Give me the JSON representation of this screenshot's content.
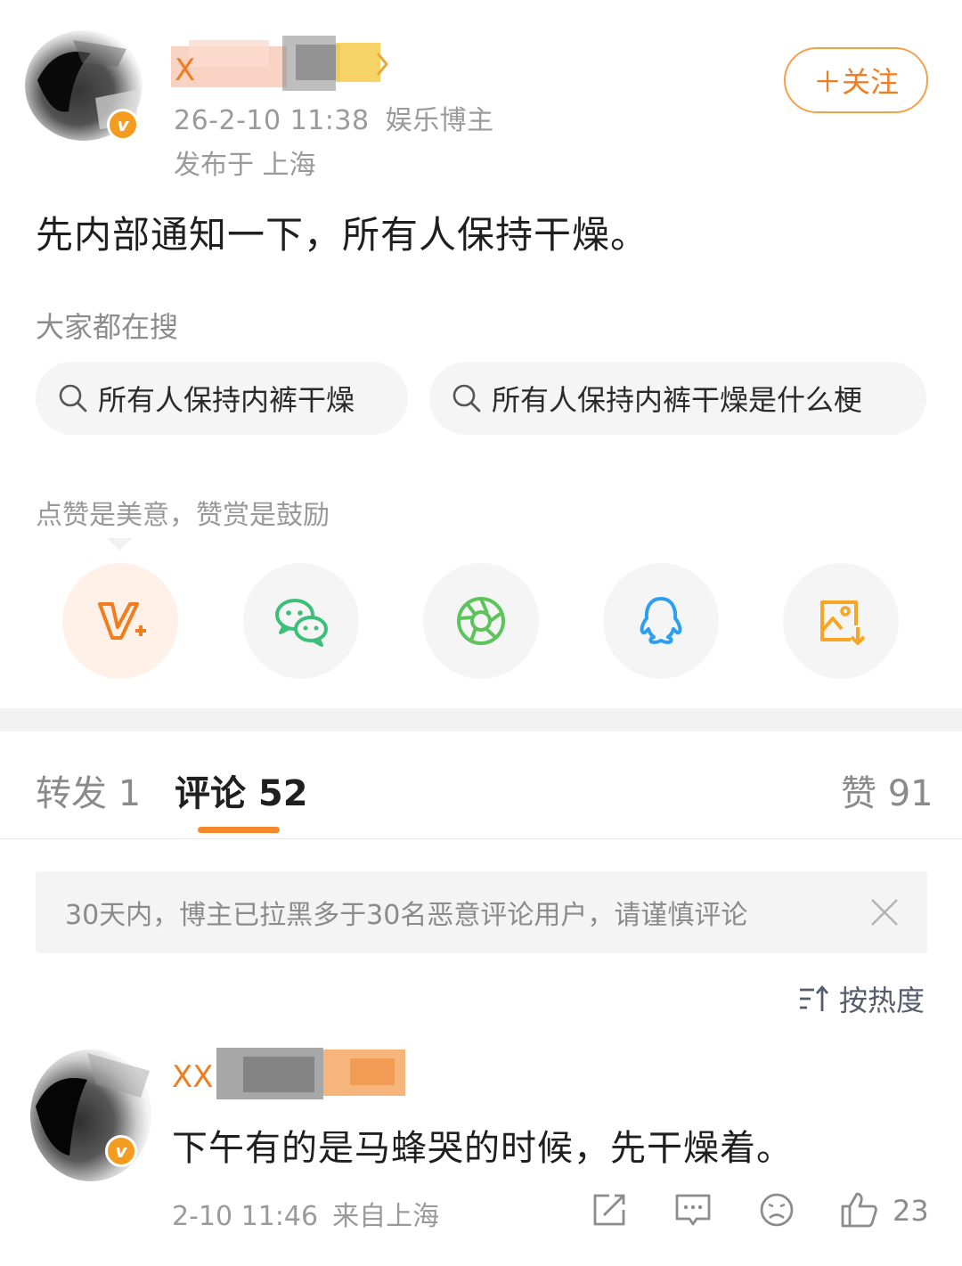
{
  "post": {
    "author_name_visible": "X",
    "time": "26-2-10 11:38",
    "author_tag": "娱乐博主",
    "location": "发布于 上海",
    "follow_label": "＋关注",
    "text": "先内部通知一下，所有人保持干燥。"
  },
  "search": {
    "title": "大家都在搜",
    "chips": [
      {
        "label": "所有人保持内裤干燥",
        "icon": "search-icon"
      },
      {
        "label": "所有人保持内裤干燥是什么梗",
        "icon": "search-icon"
      }
    ]
  },
  "reward": {
    "text": "点赞是美意，赞赏是鼓励"
  },
  "share": [
    {
      "icon": "v-plus-icon",
      "color": "#f07d20"
    },
    {
      "icon": "wechat-icon",
      "color": "#3bbf7a"
    },
    {
      "icon": "moments-icon",
      "color": "#5cc45a"
    },
    {
      "icon": "qq-icon",
      "color": "#2b9ff2"
    },
    {
      "icon": "save-image-icon",
      "color": "#f5a623"
    }
  ],
  "tabs": {
    "repost": "转发 1",
    "comments": "评论 52",
    "likes": "赞 91"
  },
  "notice": {
    "text": "30天内，博主已拉黑多于30名恶意评论用户，请谨慎评论"
  },
  "sort": {
    "label": "按热度"
  },
  "comment": {
    "author_visible": "XX",
    "text": "下午有的是马蜂哭的时候，先干燥着。",
    "time": "2-10 11:46",
    "location": "来自上海",
    "like_count": "23"
  },
  "colors": {
    "accent": "#f07d20",
    "follow_border": "#f5a04a",
    "tab_underline": "#f7872b",
    "verified_badge": "#f39c1f"
  }
}
